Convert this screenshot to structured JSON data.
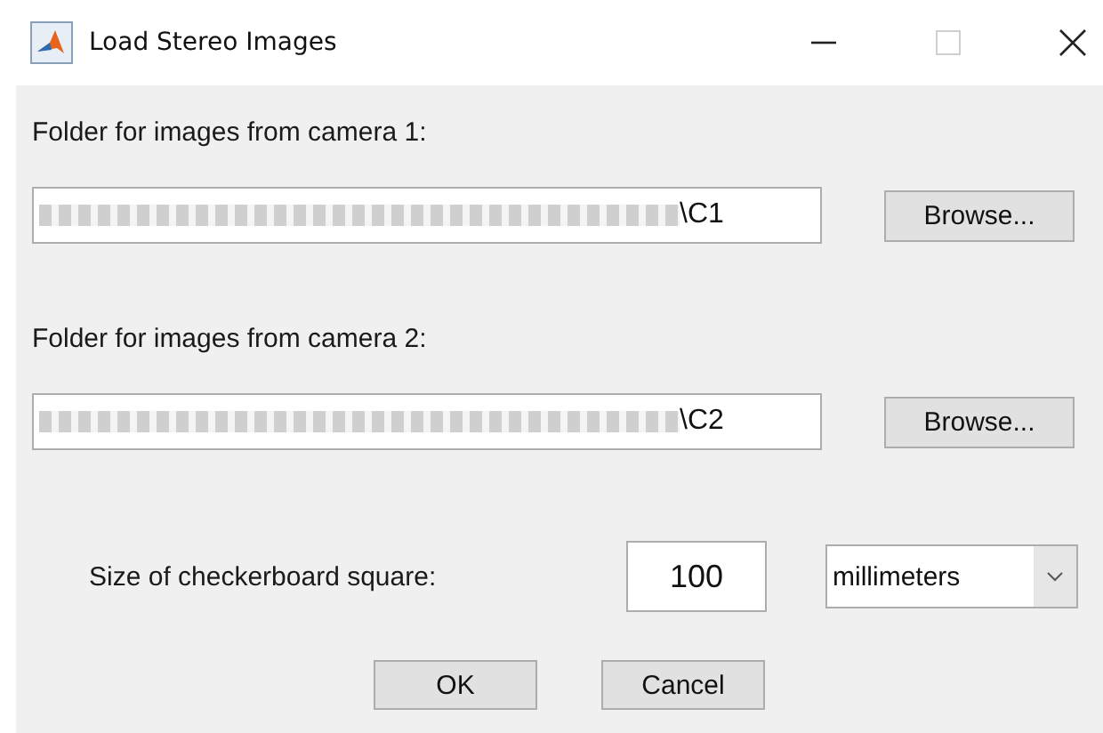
{
  "window": {
    "title": "Load Stereo Images",
    "maximize_disabled": true
  },
  "camera_folders": [
    {
      "label": "Folder for images from camera 1:",
      "value": "\\C1",
      "button": "Browse..."
    },
    {
      "label": "Folder for images from camera 2:",
      "value": "\\C2",
      "button": "Browse..."
    }
  ],
  "square_size": {
    "label": "Size of checkerboard square:",
    "value": "100",
    "unit": "millimeters"
  },
  "buttons": [
    "OK",
    "Cancel"
  ]
}
